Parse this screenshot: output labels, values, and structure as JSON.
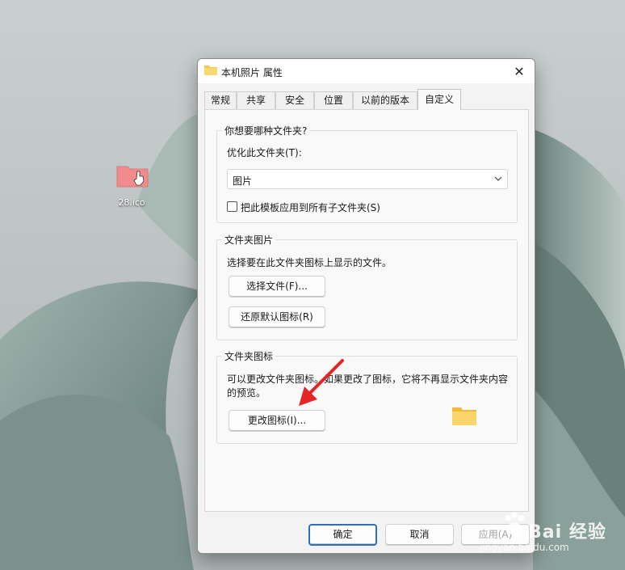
{
  "desktop": {
    "icon_label": "28.ico",
    "icon_color": "#f28b8b"
  },
  "dialog": {
    "title": "本机照片 属性",
    "tabs": [
      {
        "label": "常规"
      },
      {
        "label": "共享"
      },
      {
        "label": "安全"
      },
      {
        "label": "位置"
      },
      {
        "label": "以前的版本"
      },
      {
        "label": "自定义"
      }
    ],
    "active_tab": "自定义",
    "folder_type_group": {
      "legend": "你想要哪种文件夹?",
      "optimize_label": "优化此文件夹(T):",
      "dropdown_value": "图片",
      "checkbox_label": "把此模板应用到所有子文件夹(S)",
      "checkbox_checked": false
    },
    "folder_picture_group": {
      "legend": "文件夹图片",
      "description": "选择要在此文件夹图标上显示的文件。",
      "choose_file_button": "选择文件(F)...",
      "restore_default_button": "还原默认图标(R)"
    },
    "folder_icon_group": {
      "legend": "文件夹图标",
      "description_line1": "可以更改文件夹图标。如果更改了图标，它将不再显示文件夹内容",
      "description_line2": "的预览。",
      "change_icon_button": "更改图标(I)..."
    },
    "footer": {
      "ok_label": "确定",
      "cancel_label": "取消",
      "apply_label": "应用(A)"
    }
  },
  "watermark": {
    "brand": "Bai 经验",
    "url": "jingyan.baidu.com"
  },
  "colors": {
    "accent": "#2b6fc1",
    "arrow": "#e52424",
    "folder_yellow": "#f8c94a"
  }
}
